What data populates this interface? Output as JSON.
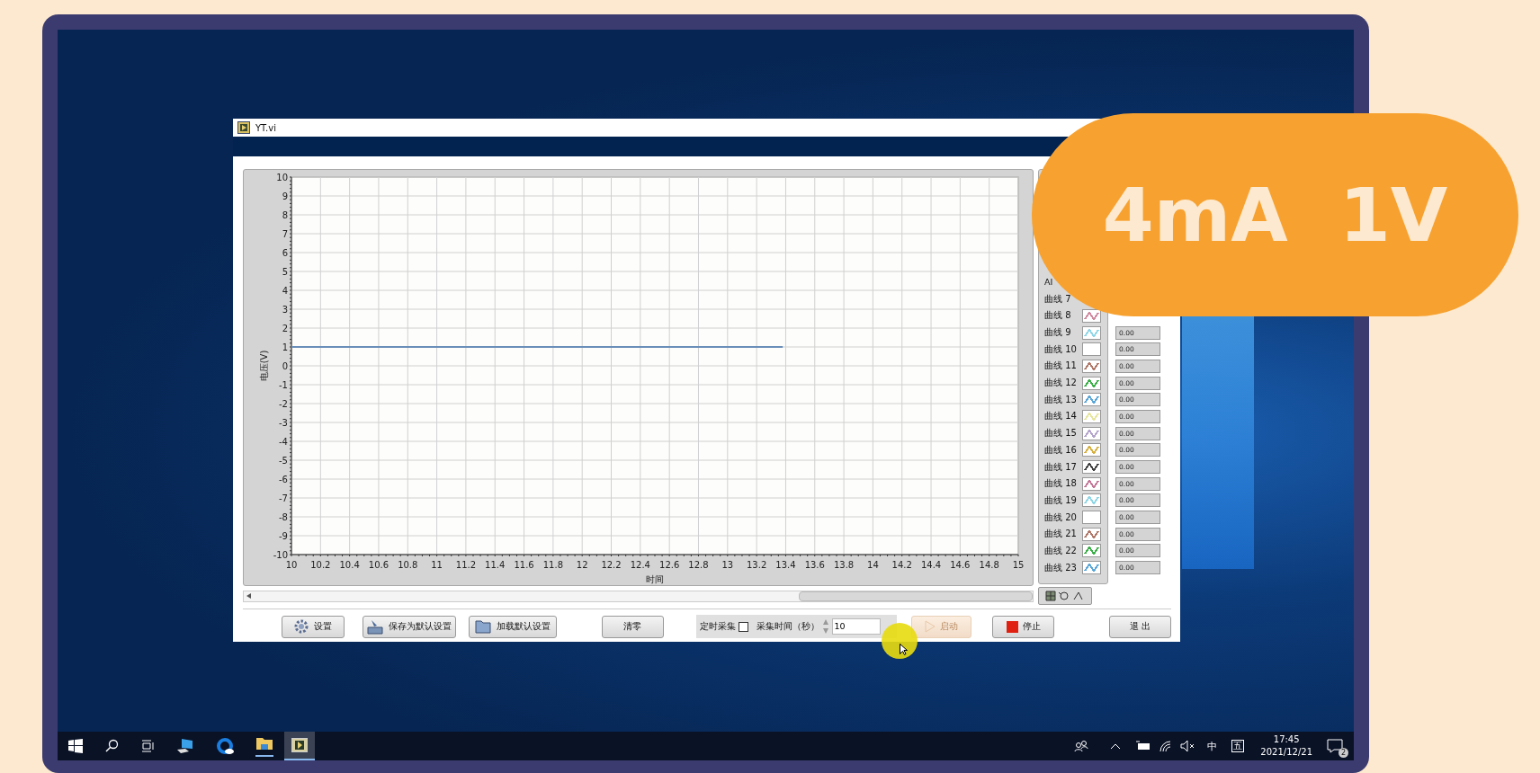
{
  "window": {
    "title": "YT.vi"
  },
  "chart": {
    "chart_data": {
      "type": "line",
      "xlabel": "时间",
      "ylabel": "电压(V)",
      "x": [
        10,
        13.38
      ],
      "series": [
        {
          "color": "#6a8fb8",
          "values": [
            1,
            1
          ]
        }
      ],
      "grid": true,
      "xlim": [
        10,
        15
      ],
      "ylim": [
        -10,
        10
      ],
      "xticks": [
        {
          "value": 10,
          "label": "10"
        },
        {
          "value": 10.2,
          "label": "10.2"
        },
        {
          "value": 10.4,
          "label": "10.4"
        },
        {
          "value": 10.6,
          "label": "10.6"
        },
        {
          "value": 10.8,
          "label": "10.8"
        },
        {
          "value": 11,
          "label": "11"
        },
        {
          "value": 11.2,
          "label": "11.2"
        },
        {
          "value": 11.4,
          "label": "11.4"
        },
        {
          "value": 11.6,
          "label": "11.6"
        },
        {
          "value": 11.8,
          "label": "11.8"
        },
        {
          "value": 12,
          "label": "12"
        },
        {
          "value": 12.2,
          "label": "12.2"
        },
        {
          "value": 12.4,
          "label": "12.4"
        },
        {
          "value": 12.6,
          "label": "12.6"
        },
        {
          "value": 12.8,
          "label": "12.8"
        },
        {
          "value": 13,
          "label": "13"
        },
        {
          "value": 13.2,
          "label": "13.2"
        },
        {
          "value": 13.4,
          "label": "13.4"
        },
        {
          "value": 13.6,
          "label": "13.6"
        },
        {
          "value": 13.8,
          "label": "13.8"
        },
        {
          "value": 14,
          "label": "14"
        },
        {
          "value": 14.2,
          "label": "14.2"
        },
        {
          "value": 14.4,
          "label": "14.4"
        },
        {
          "value": 14.6,
          "label": "14.6"
        },
        {
          "value": 14.8,
          "label": "14.8"
        },
        {
          "value": 15,
          "label": "15"
        }
      ],
      "yticks": [
        10,
        9,
        8,
        7,
        6,
        5,
        4,
        3,
        2,
        1,
        0,
        -1,
        -2,
        -3,
        -4,
        -5,
        -6,
        -7,
        -8,
        -9,
        -10
      ]
    }
  },
  "legend": {
    "header": "AI",
    "items": [
      {
        "label": "曲线 7",
        "kind": "covered"
      },
      {
        "label": "曲线 8",
        "kind": "line",
        "color": "#d08aa0"
      },
      {
        "label": "曲线 9",
        "kind": "line",
        "color": "#8fd6e6",
        "value": "0.00"
      },
      {
        "label": "曲线 10",
        "kind": "blank",
        "value": "0.00"
      },
      {
        "label": "曲线 11",
        "kind": "line",
        "color": "#b07868",
        "value": "0.00"
      },
      {
        "label": "曲线 12",
        "kind": "line",
        "color": "#3cae48",
        "value": "0.00"
      },
      {
        "label": "曲线 13",
        "kind": "line",
        "color": "#5aa6d6",
        "value": "0.00"
      },
      {
        "label": "曲线 14",
        "kind": "line",
        "color": "#e6e6a0",
        "value": "0.00"
      },
      {
        "label": "曲线 15",
        "kind": "line",
        "color": "#b4a4cc",
        "value": "0.00"
      },
      {
        "label": "曲线 16",
        "kind": "line",
        "color": "#d6b040",
        "value": "0.00"
      },
      {
        "label": "曲线 17",
        "kind": "line",
        "color": "#404040",
        "value": "0.00"
      },
      {
        "label": "曲线 18",
        "kind": "line",
        "color": "#c47898",
        "value": "0.00"
      },
      {
        "label": "曲线 19",
        "kind": "line",
        "color": "#8fd6e6",
        "value": "0.00"
      },
      {
        "label": "曲线 20",
        "kind": "blank",
        "value": "0.00"
      },
      {
        "label": "曲线 21",
        "kind": "line",
        "color": "#b07868",
        "value": "0.00"
      },
      {
        "label": "曲线 22",
        "kind": "line",
        "color": "#3cae48",
        "value": "0.00"
      },
      {
        "label": "曲线 23",
        "kind": "line",
        "color": "#5aa6d6",
        "value": "0.00"
      }
    ]
  },
  "buttons": [
    {
      "kind": "settings",
      "label": "设置",
      "disabled": false
    },
    {
      "kind": "save",
      "label": "保存为默认设置",
      "disabled": false
    },
    {
      "kind": "load",
      "label": "加载默认设置",
      "disabled": false
    },
    {
      "kind": "plain",
      "label": "清零",
      "disabled": false
    }
  ],
  "timer": {
    "label": "定时采集",
    "checked": false,
    "time_label": "采集时间（秒）",
    "time_value": "10"
  },
  "run_buttons": [
    {
      "kind": "start",
      "label": "启动",
      "disabled": true
    },
    {
      "kind": "stop",
      "label": "停止",
      "disabled": false
    },
    {
      "kind": "plain",
      "label": "退 出",
      "disabled": false
    }
  ],
  "taskbar": {
    "ime": "中",
    "ime_mode": "五",
    "time": "17:45",
    "date": "2021/12/21",
    "notifications": "2"
  },
  "overlay": {
    "text": "4mA  1V"
  }
}
